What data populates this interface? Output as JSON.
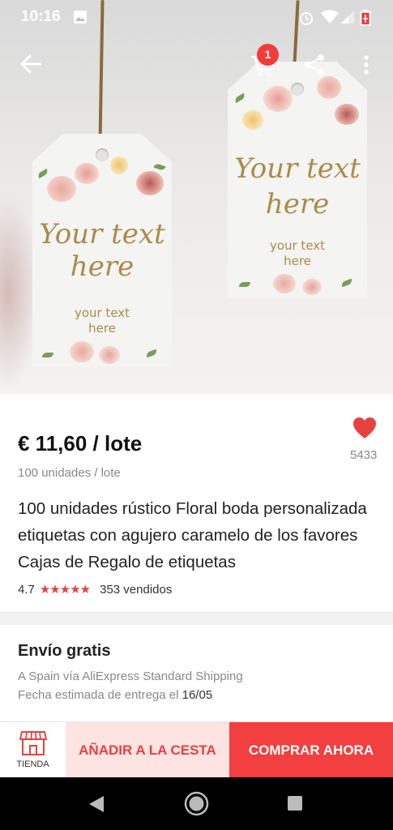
{
  "status_bar": {
    "time": "10:16"
  },
  "header": {
    "cart_badge": "1"
  },
  "image": {
    "tag_main_line1": "Your text",
    "tag_main_line2": "here",
    "tag_sub_line1": "your text",
    "tag_sub_line2": "here"
  },
  "product": {
    "price": "€ 11,60 / lote",
    "unit": "100 unidades / lote",
    "wishlist_count": "5433",
    "title": "100 unidades rústico Floral boda personalizada etiquetas con agujero caramelo de los favores Cajas de Regalo de etiquetas",
    "rating": "4.7",
    "stars": "★★★★★",
    "sold": "353 vendidos"
  },
  "shipping": {
    "title": "Envío gratis",
    "line1": "A Spain vía AliExpress Standard Shipping",
    "line2_prefix": "Fecha estimada de entrega el ",
    "line2_date": "16/05"
  },
  "actions": {
    "store_label": "TIENDA",
    "add_to_cart": "AÑADIR A LA CESTA",
    "buy_now": "COMPRAR AHORA"
  },
  "colors": {
    "accent": "#f23f3f",
    "accent_light": "#fde3e2",
    "price_text": "#111111",
    "tag_gold": "#a98b4c"
  },
  "icons": [
    "back-arrow-icon",
    "cart-icon",
    "share-icon",
    "more-vertical-icon",
    "heart-icon",
    "store-icon",
    "nav-back-icon",
    "nav-home-icon",
    "nav-recents-icon",
    "alarm-icon",
    "wifi-icon",
    "signal-icon",
    "battery-icon",
    "gallery-icon"
  ]
}
